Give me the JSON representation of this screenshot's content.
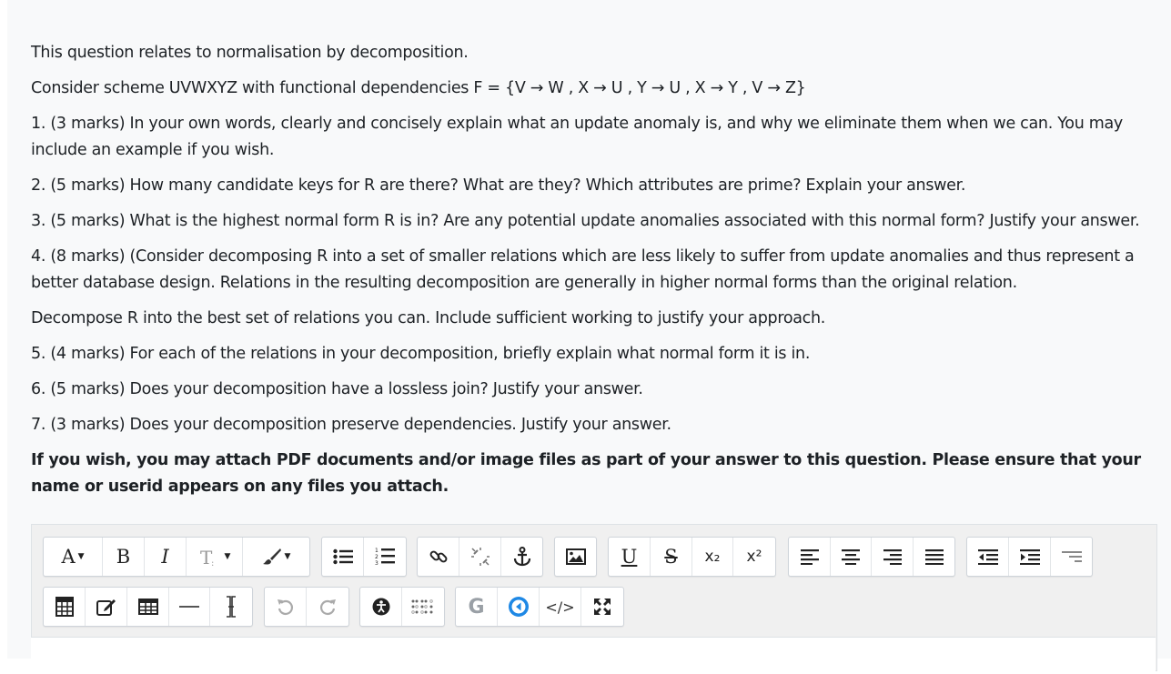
{
  "question": {
    "intro": "This question relates to normalisation by decomposition.",
    "scheme": "Consider scheme UVWXYZ with functional dependencies F = {V → W , X → U , Y → U , X → Y , V → Z}",
    "q1": "1. (3 marks) In your own words, clearly and concisely explain what an update anomaly is, and why we eliminate them when we can. You may include an example if you wish.",
    "q2": "2. (5 marks) How many candidate keys for R are there? What are they? Which attributes are prime? Explain your answer.",
    "q3": "3. (5 marks) What is the highest normal form R is in? Are any potential update anomalies associated with this normal form? Justify your answer.",
    "q4": "4. (8 marks) (Consider decomposing R into a set of smaller relations which are less likely to suffer from update anomalies and thus represent a better database design.   Relations in the resulting decomposition are generally in higher normal forms than the original relation.",
    "decompose": "Decompose R into the best set of relations you can. Include sufficient working to justify your approach.",
    "q5": "5. (4 marks) For each of the relations in your decomposition, briefly explain what normal form it is in.",
    "q6": "6. (5 marks) Does your decomposition have a lossless join? Justify your answer.",
    "q7": "7. (3 marks) Does your decomposition preserve dependencies. Justify your answer.",
    "attach_note_1": "If you wish, you may attach PDF documents and/or image files as part of your answer to this question.  Please ensure that your name or userid appears on any files you attach."
  },
  "toolbar": {
    "font_label": "A",
    "bold_label": "B",
    "italic_label": "I",
    "underline_label": "U",
    "strike_label": "S",
    "sub_label": "x₂",
    "sup_label": "x²",
    "g_label": "G",
    "code_label": "</>"
  }
}
